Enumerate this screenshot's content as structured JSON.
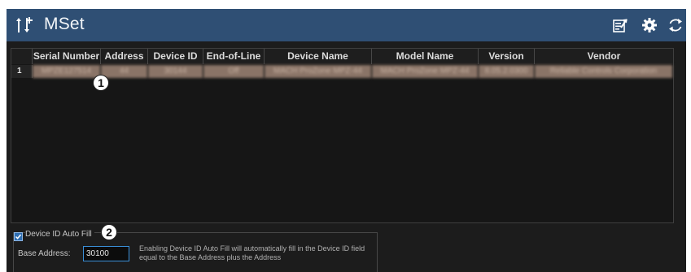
{
  "app": {
    "title": "MSet",
    "icon": "add-device-icon"
  },
  "toolbar": {
    "icons": [
      "export-list-icon",
      "gear-icon",
      "refresh-icon"
    ]
  },
  "grid": {
    "columns": [
      "Serial Number",
      "Address",
      "Device ID",
      "End-of-Line",
      "Device Name",
      "Model Name",
      "Version",
      "Vendor"
    ],
    "rows": [
      {
        "row_number": "1",
        "cells": [
          "MPZE127514",
          "44",
          "30144",
          "Off",
          "MACH ProZone MPZ-44",
          "MACH ProZone MPZ-44",
          "8.05.2.0300",
          "Reliable Controls Corporation"
        ]
      }
    ]
  },
  "callouts": {
    "one": "1",
    "two": "2"
  },
  "settings": {
    "autofill_label": "Device ID Auto Fill",
    "autofill_checked": true,
    "base_address_label": "Base Address:",
    "base_address_value": "30100",
    "help_text": "Enabling Device ID Auto Fill will automatically fill in the Device ID field equal to the Base Address plus the Address"
  },
  "colors": {
    "titlebar": "#2f4f74",
    "background": "#1c1c1c",
    "accent": "#3a8fd8",
    "redacted_cell": "#8a7467"
  }
}
